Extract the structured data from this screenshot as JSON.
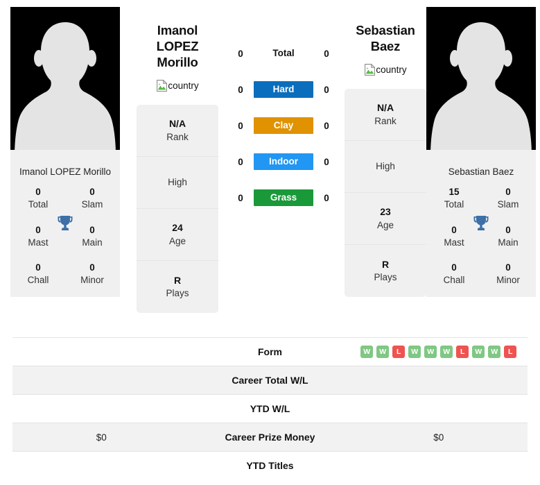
{
  "players": {
    "left": {
      "name_line1": "Imanol LOPEZ",
      "name_line2": "Morillo",
      "flag_alt": "country",
      "short_name": "Imanol LOPEZ Morillo",
      "stats": [
        {
          "value": "N/A",
          "label": "Rank"
        },
        {
          "value": "",
          "label": "High"
        },
        {
          "value": "24",
          "label": "Age"
        },
        {
          "value": "R",
          "label": "Plays"
        }
      ],
      "titles": [
        {
          "value": "0",
          "label": "Total"
        },
        {
          "value": "0",
          "label": "Slam"
        },
        {
          "value": "0",
          "label": "Mast"
        },
        {
          "value": "0",
          "label": "Main"
        },
        {
          "value": "0",
          "label": "Chall"
        },
        {
          "value": "0",
          "label": "Minor"
        }
      ],
      "career_prize_money": "$0",
      "career_total_wl": "",
      "ytd_wl": "",
      "ytd_titles": ""
    },
    "right": {
      "name_line1": "Sebastian",
      "name_line2": "Baez",
      "flag_alt": "country",
      "short_name": "Sebastian Baez",
      "stats": [
        {
          "value": "N/A",
          "label": "Rank"
        },
        {
          "value": "",
          "label": "High"
        },
        {
          "value": "23",
          "label": "Age"
        },
        {
          "value": "R",
          "label": "Plays"
        }
      ],
      "titles": [
        {
          "value": "15",
          "label": "Total"
        },
        {
          "value": "0",
          "label": "Slam"
        },
        {
          "value": "0",
          "label": "Mast"
        },
        {
          "value": "0",
          "label": "Main"
        },
        {
          "value": "0",
          "label": "Chall"
        },
        {
          "value": "0",
          "label": "Minor"
        }
      ],
      "career_prize_money": "$0",
      "career_total_wl": "",
      "ytd_wl": "",
      "ytd_titles": ""
    }
  },
  "surfaces": [
    {
      "label": "Total",
      "left": "0",
      "right": "0",
      "color": "transparent",
      "plain": true
    },
    {
      "label": "Hard",
      "left": "0",
      "right": "0",
      "color": "#0a6ebd",
      "plain": false
    },
    {
      "label": "Clay",
      "left": "0",
      "right": "0",
      "color": "#e09200",
      "plain": false
    },
    {
      "label": "Indoor",
      "left": "0",
      "right": "0",
      "color": "#2196f3",
      "plain": false
    },
    {
      "label": "Grass",
      "left": "0",
      "right": "0",
      "color": "#1a9939",
      "plain": false
    }
  ],
  "table_rows": [
    {
      "label": "Form",
      "left": "",
      "right": ""
    },
    {
      "label": "Career Total W/L",
      "left": "",
      "right": ""
    },
    {
      "label": "YTD W/L",
      "left": "",
      "right": ""
    },
    {
      "label": "Career Prize Money",
      "left": "$0",
      "right": "$0"
    },
    {
      "label": "YTD Titles",
      "left": "",
      "right": ""
    }
  ],
  "form": {
    "right_results": [
      "W",
      "W",
      "L",
      "W",
      "W",
      "W",
      "L",
      "W",
      "W",
      "L"
    ],
    "left_results": [],
    "win_color": "#81c784",
    "loss_color": "#ef5350"
  },
  "colors": {
    "card_bg": "#f0f0f0",
    "stripe_bg": "#f2f2f2",
    "trophy": "#3d6fa8",
    "avatar_bg": "#000000",
    "avatar_fill": "#e4e4e4"
  }
}
